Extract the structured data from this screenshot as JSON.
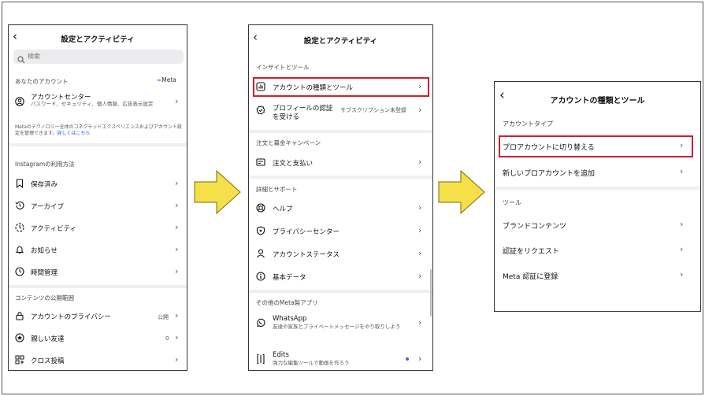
{
  "p1": {
    "title": "設定とアクティビティ",
    "search_placeholder": "検索",
    "your_account_header": "あなたのアカウント",
    "meta_logo": "Meta",
    "account_center_title": "アカウントセンター",
    "account_center_sub": "パスワード、セキュリティ、個人情報、広告表示設定",
    "meta_note": "Metaのテクノロジー全体のコネクテッドエクスペリエンスおよびアカウント設定を管理できます。",
    "meta_note_link": "詳しくはこちら",
    "how_use_header": "Instagramの利用方法",
    "items_use": [
      "保存済み",
      "アーカイブ",
      "アクティビティ",
      "お知らせ",
      "時間管理"
    ],
    "publish_header": "コンテンツの公開範囲",
    "privacy_label": "アカウントのプライバシー",
    "privacy_value": "公開",
    "close_friends_label": "親しい友達",
    "close_friends_value": "0",
    "crosspost_label": "クロス投稿"
  },
  "p2": {
    "title": "設定とアクティビティ",
    "insights_header": "インサイトとツール",
    "account_type_tools": "アカウントの種類とツール",
    "verification_label": "プロフィールの認証を受ける",
    "verification_value": "サブスクリプション未登録",
    "orders_header": "注文と募金キャンペーン",
    "orders_payments": "注文と支払い",
    "details_header": "詳細とサポート",
    "help": "ヘルプ",
    "privacy_center": "プライバシーセンター",
    "account_status": "アカウントステータス",
    "basic_data": "基本データ",
    "other_apps_header": "その他のMeta製アプリ",
    "whatsapp_title": "WhatsApp",
    "whatsapp_sub": "友達や家族とプライベートメッセージをやり取りしよう",
    "edits_title": "Edits",
    "edits_sub": "強力な編集ツールで動画を作ろう"
  },
  "p3": {
    "title": "アカウントの種類とツール",
    "account_type_header": "アカウントタイプ",
    "switch_pro": "プロアカウントに切り替える",
    "add_pro": "新しいプロアカウントを追加",
    "tools_header": "ツール",
    "branded_content": "ブランドコンテンツ",
    "request_verification": "認証をリクエスト",
    "meta_verified": "Meta 認証に登録"
  },
  "colors": {
    "highlight": "#d31d2b",
    "arrow_fill": "#f5e04a",
    "link": "#1b5ed8"
  },
  "icons": {
    "back": "back-chevron-icon",
    "chevron": "chevron-right-icon"
  }
}
